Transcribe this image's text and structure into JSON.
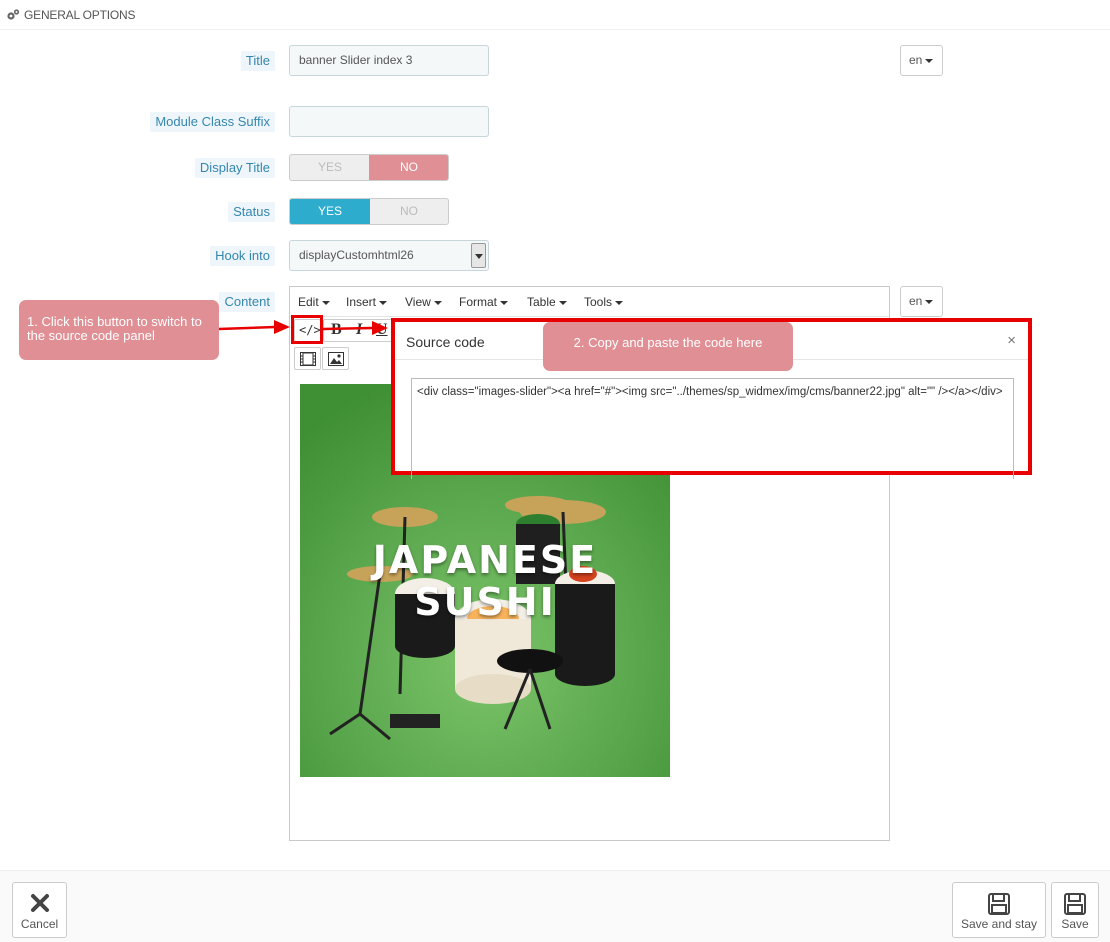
{
  "header": {
    "title": "GENERAL OPTIONS"
  },
  "form": {
    "title_label": "Title",
    "title_value": "banner Slider index 3",
    "lang_value": "en",
    "module_class_suffix_label": "Module Class Suffix",
    "module_class_suffix_value": "",
    "display_title_label": "Display Title",
    "display_title_yes": "YES",
    "display_title_no": "NO",
    "display_title_selected": "NO",
    "status_label": "Status",
    "status_yes": "YES",
    "status_no": "NO",
    "status_selected": "YES",
    "hook_into_label": "Hook into",
    "hook_into_value": "displayCustomhtml26",
    "content_label": "Content",
    "content_lang_value": "en"
  },
  "editor": {
    "menus": [
      "Edit",
      "Insert",
      "View",
      "Format",
      "Table",
      "Tools"
    ],
    "toolbar": {
      "source_code": "</>",
      "bold": "B",
      "italic": "I",
      "underline": "U"
    },
    "image_text_line1": "JAPANESE",
    "image_text_line2": "SUSHI"
  },
  "modal": {
    "title": "Source code",
    "close": "×",
    "code": "<div class=\"images-slider\"><a href=\"#\"><img src=\"../themes/sp_widmex/img/cms/banner22.jpg\" alt=\"\" /></a></div>"
  },
  "annotations": {
    "step1": "1. Click this button to switch to the source code panel",
    "step2": "2. Copy and paste the code here"
  },
  "footer": {
    "cancel": "Cancel",
    "save_and_stay": "Save and stay",
    "save": "Save"
  },
  "colors": {
    "label_text": "#3586ae",
    "label_bg": "#eef6fb",
    "switch_no_on": "#e08f95",
    "switch_yes_on": "#2eacce",
    "annotation_red": "#e80000",
    "callout_bg": "#e08f95"
  }
}
